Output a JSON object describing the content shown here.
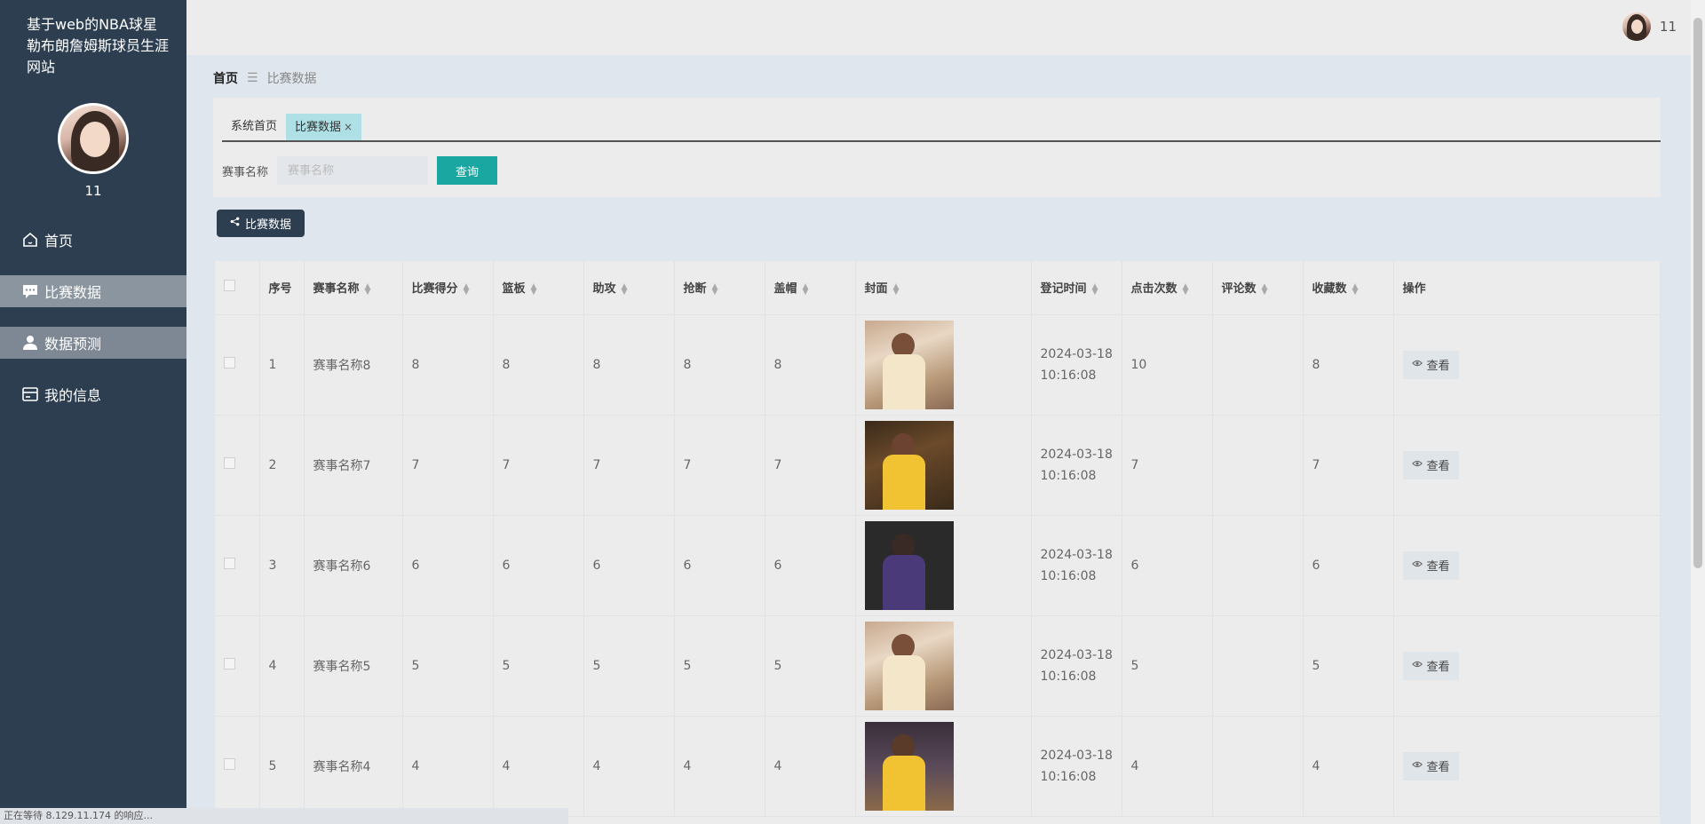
{
  "sidebar": {
    "site_title": "基于web的NBA球星勒布朗詹姆斯球员生涯网站",
    "username": "11",
    "items": [
      {
        "label": "首页",
        "icon": "home-icon"
      },
      {
        "label": "比赛数据",
        "icon": "chat-icon"
      },
      {
        "label": "数据预测",
        "icon": "user-icon"
      },
      {
        "label": "我的信息",
        "icon": "card-icon"
      }
    ]
  },
  "topbar": {
    "username": "11"
  },
  "breadcrumb": {
    "home": "首页",
    "separator": "☰",
    "current": "比赛数据"
  },
  "tabs": [
    {
      "label": "系统首页"
    },
    {
      "label": "比赛数据",
      "close": "×"
    }
  ],
  "search": {
    "label": "赛事名称",
    "placeholder": "赛事名称",
    "button": "查询"
  },
  "action_button": "比赛数据",
  "table": {
    "headers": [
      "序号",
      "赛事名称",
      "比赛得分",
      "篮板",
      "助攻",
      "抢断",
      "盖帽",
      "封面",
      "登记时间",
      "点击次数",
      "评论数",
      "收藏数",
      "操作"
    ],
    "view_label": "查看",
    "rows": [
      {
        "index": "1",
        "name": "赛事名称8",
        "score": "8",
        "rebounds": "8",
        "assists": "8",
        "steals": "8",
        "blocks": "8",
        "date": "2024-03-18",
        "time": "10:16:08",
        "clicks": "10",
        "comments": "",
        "favorites": "8"
      },
      {
        "index": "2",
        "name": "赛事名称7",
        "score": "7",
        "rebounds": "7",
        "assists": "7",
        "steals": "7",
        "blocks": "7",
        "date": "2024-03-18",
        "time": "10:16:08",
        "clicks": "7",
        "comments": "",
        "favorites": "7"
      },
      {
        "index": "3",
        "name": "赛事名称6",
        "score": "6",
        "rebounds": "6",
        "assists": "6",
        "steals": "6",
        "blocks": "6",
        "date": "2024-03-18",
        "time": "10:16:08",
        "clicks": "6",
        "comments": "",
        "favorites": "6"
      },
      {
        "index": "4",
        "name": "赛事名称5",
        "score": "5",
        "rebounds": "5",
        "assists": "5",
        "steals": "5",
        "blocks": "5",
        "date": "2024-03-18",
        "time": "10:16:08",
        "clicks": "5",
        "comments": "",
        "favorites": "5"
      },
      {
        "index": "5",
        "name": "赛事名称4",
        "score": "4",
        "rebounds": "4",
        "assists": "4",
        "steals": "4",
        "blocks": "4",
        "date": "2024-03-18",
        "time": "10:16:08",
        "clicks": "4",
        "comments": "",
        "favorites": "4"
      }
    ]
  },
  "status_bar": "正在等待 8.129.11.174 的响应...",
  "colors": {
    "sidebar": "#2c3e50",
    "accent": "#1aa7a1",
    "active_tab": "#aee0e6"
  }
}
